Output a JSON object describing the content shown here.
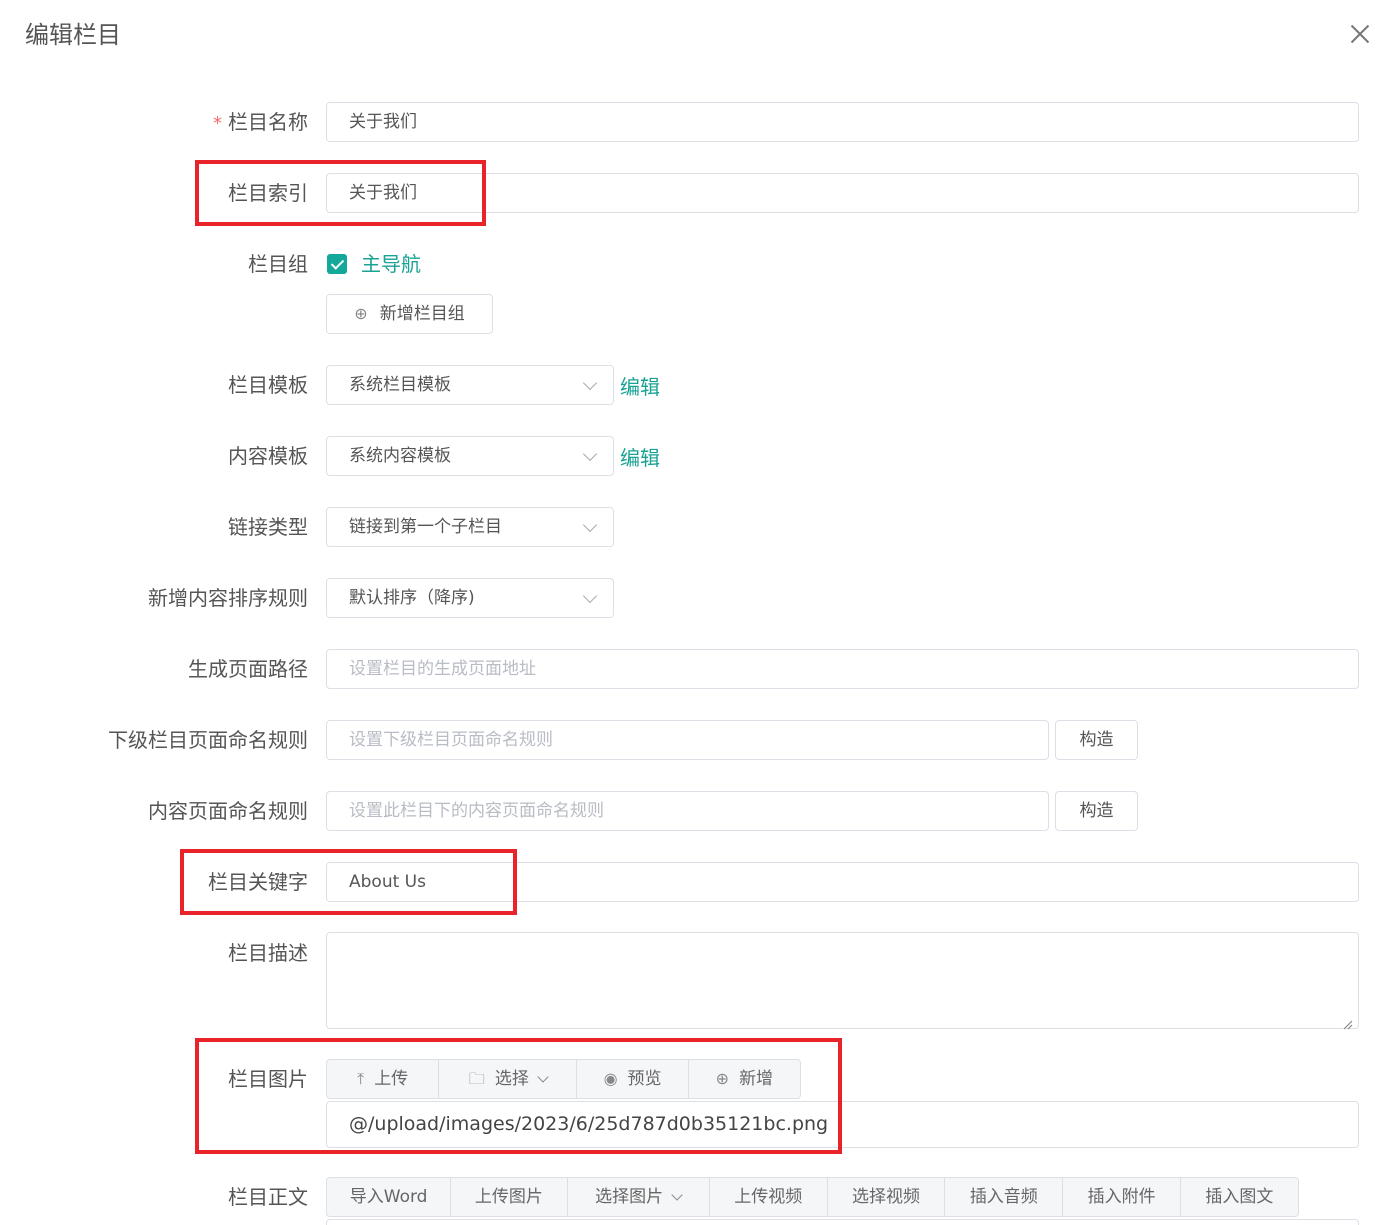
{
  "dialog": {
    "title": "编辑栏目"
  },
  "fields": {
    "name": {
      "label": "栏目名称",
      "required_mark": "*",
      "value": "关于我们"
    },
    "index": {
      "label": "栏目索引",
      "value": "关于我们"
    },
    "group": {
      "label": "栏目组",
      "checkbox_label": "主导航",
      "checked": true,
      "add_button": "新增栏目组"
    },
    "channel_template": {
      "label": "栏目模板",
      "value": "系统栏目模板",
      "edit_link": "编辑"
    },
    "content_template": {
      "label": "内容模板",
      "value": "系统内容模板",
      "edit_link": "编辑"
    },
    "link_type": {
      "label": "链接类型",
      "value": "链接到第一个子栏目"
    },
    "sort_rule": {
      "label": "新增内容排序规则",
      "value": "默认排序（降序)"
    },
    "page_path": {
      "label": "生成页面路径",
      "placeholder": "设置栏目的生成页面地址"
    },
    "child_naming": {
      "label": "下级栏目页面命名规则",
      "placeholder": "设置下级栏目页面命名规则",
      "build_button": "构造"
    },
    "content_naming": {
      "label": "内容页面命名规则",
      "placeholder": "设置此栏目下的内容页面命名规则",
      "build_button": "构造"
    },
    "keywords": {
      "label": "栏目关键字",
      "value": "About Us"
    },
    "description": {
      "label": "栏目描述",
      "value": ""
    },
    "image": {
      "label": "栏目图片",
      "upload": "上传",
      "select": "选择",
      "preview": "预览",
      "add": "新增",
      "value": "@/upload/images/2023/6/25d787d0b35121bc.png"
    },
    "body": {
      "label": "栏目正文",
      "toolbar": [
        "导入Word",
        "上传图片",
        "选择图片",
        "上传视频",
        "选择视频",
        "插入音频",
        "插入附件",
        "插入图文"
      ]
    }
  },
  "colors": {
    "accent": "#1aa295",
    "highlight": "#e8232a"
  }
}
